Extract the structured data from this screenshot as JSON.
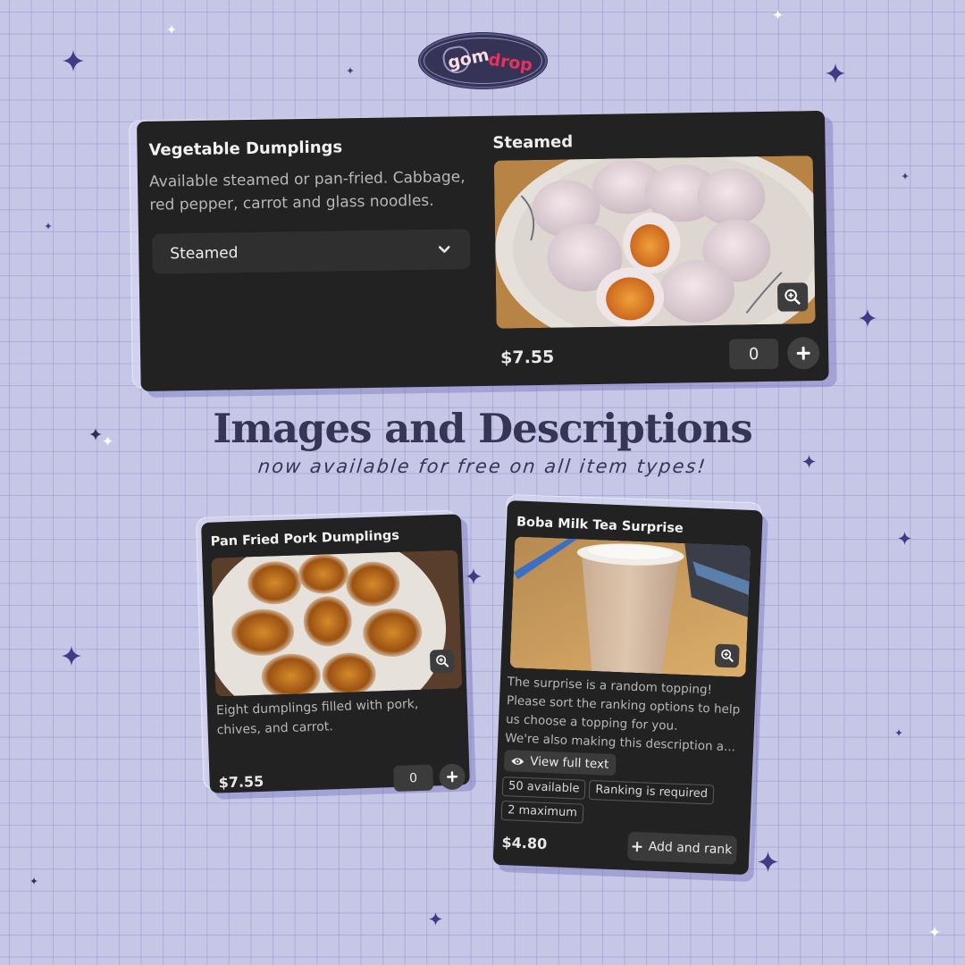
{
  "brand": {
    "logo_part1": "gom",
    "logo_part2": "drop",
    "accent_color": "#e8305c",
    "dark_color": "#363556"
  },
  "headline": {
    "title": "Images and Descriptions",
    "subtitle": "now available for free on all item types!"
  },
  "cards": {
    "vegetable": {
      "title": "Vegetable Dumplings",
      "description": "Available steamed or pan-fried. Cabbage, red pepper, carrot and glass noodles.",
      "select_value": "Steamed",
      "option_label": "Steamed",
      "image_alt": "Steamed vegetable dumplings on a floral plate",
      "zoom_icon": "zoom-in-icon",
      "price": "$7.55",
      "quantity": "0",
      "add_icon": "plus-icon"
    },
    "pork": {
      "title": "Pan Fried Pork Dumplings",
      "description": "Eight dumplings filled with pork, chives, and carrot.",
      "image_alt": "Pan fried pork dumplings arranged on a white plate",
      "zoom_icon": "zoom-in-icon",
      "price": "$7.55",
      "quantity": "0",
      "add_icon": "plus-icon"
    },
    "boba": {
      "title": "Boba Milk Tea Surprise",
      "description_lines": [
        "The surprise is a random topping! Please sort the ranking options to help us choose a topping for you.",
        "We're also making this description a..."
      ],
      "image_alt": "Milk tea in a plastic cup with a blue straw",
      "zoom_icon": "zoom-in-icon",
      "view_full_text": "View full text",
      "badges": [
        "50 available",
        "Ranking is required",
        "2 maximum"
      ],
      "price": "$4.80",
      "add_button": "Add and rank"
    }
  }
}
